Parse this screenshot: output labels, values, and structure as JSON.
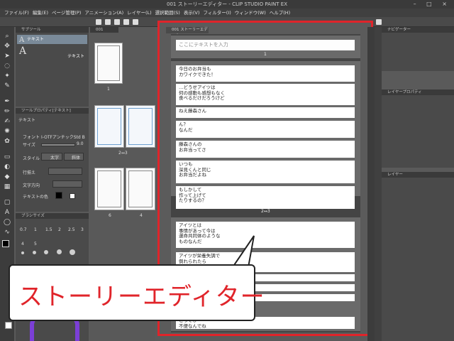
{
  "window": {
    "title": "001 ストーリーエディター - CLIP STUDIO PAINT EX",
    "controls": "– □ ×"
  },
  "menu": [
    "ファイル(F)",
    "編集(E)",
    "ページ管理(P)",
    "アニメーション(A)",
    "レイヤー(L)",
    "選択範囲(S)",
    "表示(V)",
    "フィルター(I)",
    "ウィンドウ(W)",
    "ヘルプ(H)"
  ],
  "subtool": {
    "header": "サブツール",
    "items": [
      {
        "glyph": "A",
        "label": "テキスト"
      },
      {
        "glyph": "A",
        "label": "テキスト"
      }
    ]
  },
  "tool_property": {
    "header": "ツールプロパティ[テキスト]",
    "title": "テキスト",
    "font_label": "フォント",
    "font_value": "I-OTFアンチックStd B",
    "size_label": "サイズ",
    "size_value": "9.0",
    "style_label": "スタイル",
    "style_bold": "太字",
    "style_italic": "斜体",
    "direction_label": "行揃え",
    "writing_label": "文字方向",
    "color_label": "テキストの色"
  },
  "brush_size": {
    "header": "ブラシサイズ",
    "values": [
      "0.7",
      "1",
      "1.5",
      "2",
      "2.5",
      "3",
      "4",
      "5"
    ]
  },
  "page_manager": {
    "tab": "001",
    "pages": [
      "1",
      "2",
      "3",
      "4",
      "5",
      "6"
    ],
    "spread1": "2↔3",
    "spread2": "4↔5"
  },
  "story_editor": {
    "tab": "001 ストーリーエディター",
    "input_placeholder": "ここにテキストを入力",
    "page1_label": "1",
    "spread_label": "2↔3",
    "texts_page1": [
      "今日のお弁当も\nカワイクできた！",
      "…どうせアイツは\n何の感動も感想もなく\n食べるだけだろうけど",
      "ねえ藤森さん",
      "ん？\nなんだ",
      "藤森さんの\nお弁当ってさ",
      "いつも\n深見くんと同じ\nお弁当だよね",
      "もしかして\n作って上げて\nたりするの？"
    ],
    "texts_spread": [
      "アイツとは\n事情があって今は\n運命共同体のような\nものなんだ",
      "アイツが栄養失調で\n倒れられたら",
      "",
      "",
      "",
      "とっても\n不便なんでね"
    ]
  },
  "navigator": {
    "header": "ナビゲーター"
  },
  "layer_property": {
    "header": "レイヤープロパティ"
  },
  "layer": {
    "header": "レイヤー"
  },
  "callout": {
    "text": "ストーリーエディター"
  },
  "colors": {
    "accent_red": "#e0242a",
    "panel": "#4a4a4a",
    "frame": "#3a3a3a"
  }
}
